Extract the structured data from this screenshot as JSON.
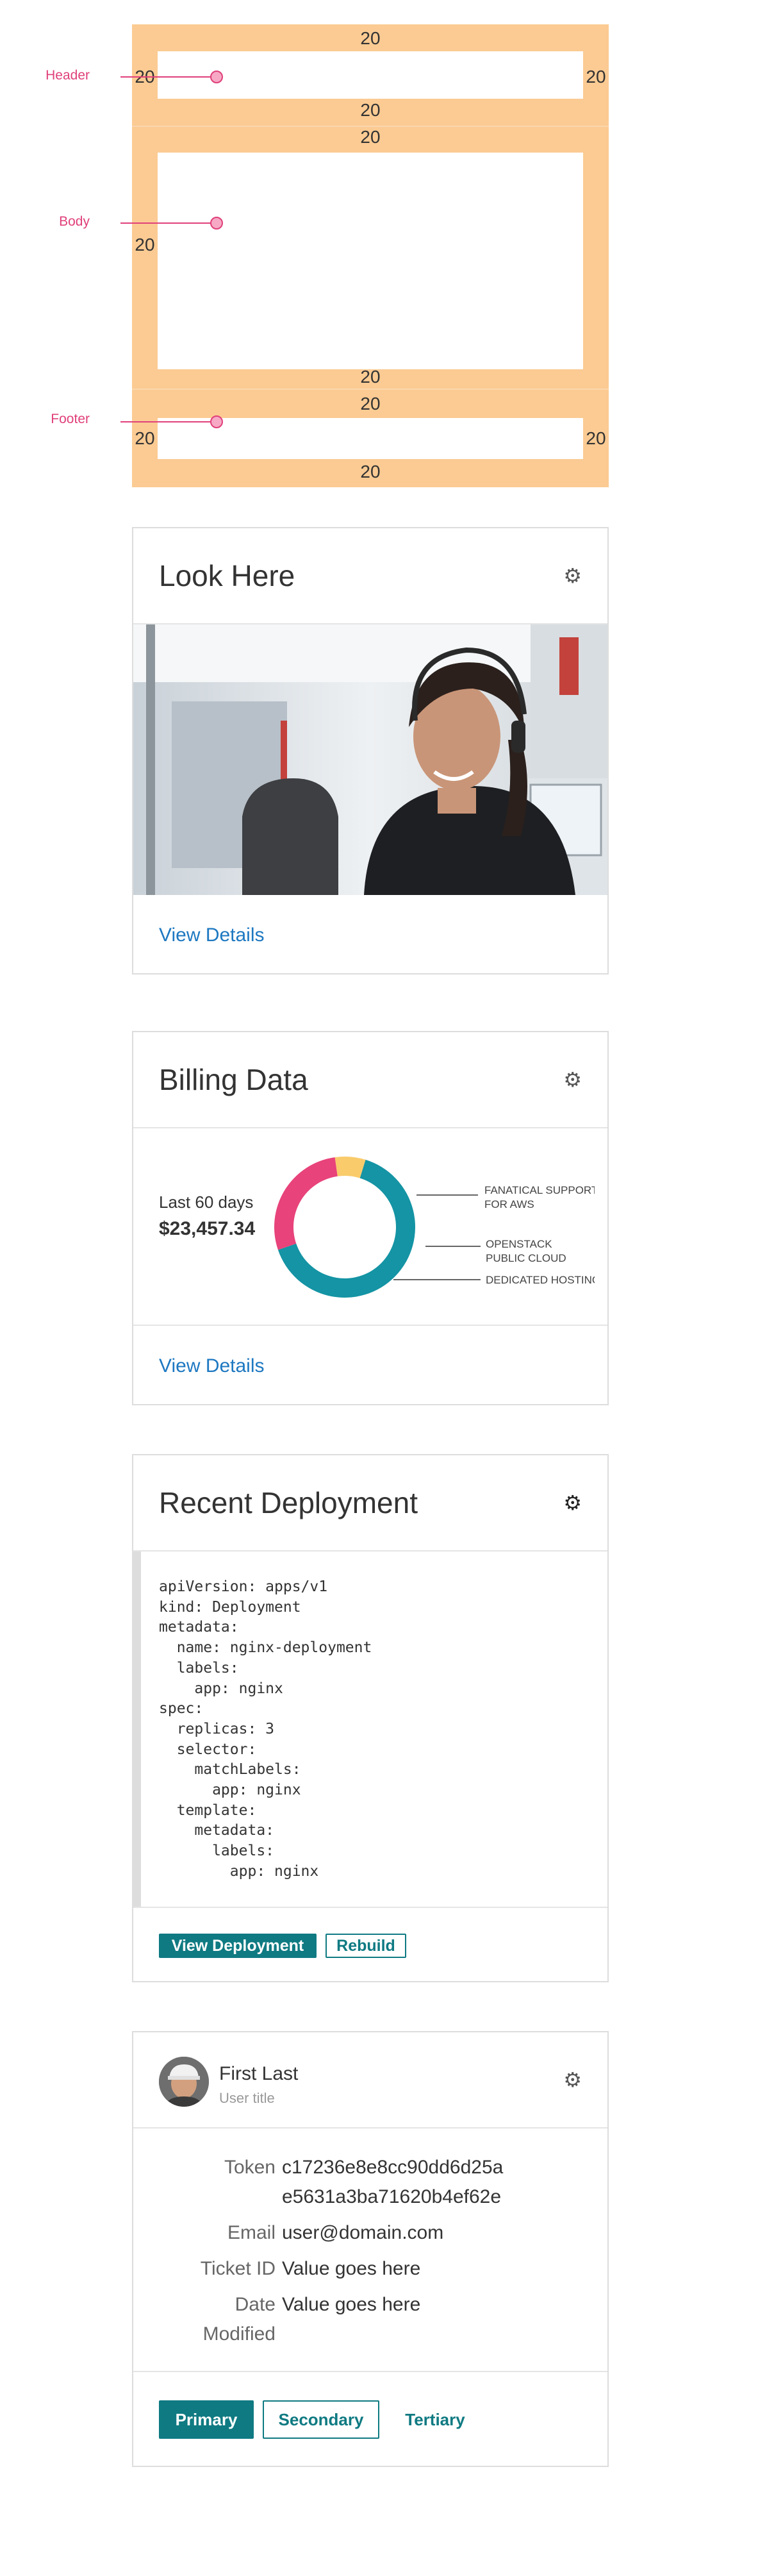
{
  "anatomy": {
    "labels": {
      "header": "Header",
      "body": "Body",
      "footer": "Footer"
    },
    "spacing": "20",
    "colors": {
      "padding": "#fbcb93",
      "callout": "#e0407a"
    }
  },
  "cards": {
    "look_here": {
      "title": "Look Here",
      "footer_link": "View Details",
      "settings_icon": "gear-icon"
    },
    "billing": {
      "title": "Billing Data",
      "period_label": "Last 60 days",
      "amount": "$23,457.34",
      "footer_link": "View Details",
      "legend": [
        {
          "line1": "FANATICAL SUPPORT",
          "line2": "FOR AWS"
        },
        {
          "line1": "OPENSTACK",
          "line2": "PUBLIC CLOUD"
        },
        {
          "line1": "DEDICATED HOSTING",
          "line2": ""
        }
      ]
    },
    "deployment": {
      "title": "Recent Deployment",
      "code": [
        "apiVersion: apps/v1",
        "kind: Deployment",
        "metadata:",
        "  name: nginx-deployment",
        "  labels:",
        "    app: nginx",
        "spec:",
        "  replicas: 3",
        "  selector:",
        "    matchLabels:",
        "      app: nginx",
        "  template:",
        "    metadata:",
        "      labels:",
        "        app: nginx"
      ],
      "primary_button": "View Deployment",
      "secondary_button": "Rebuild"
    },
    "user": {
      "name": "First Last",
      "subtitle": "User title",
      "fields": {
        "token_label": "Token",
        "token_line1": "c17236e8e8cc90dd6d25a",
        "token_line2": "e5631a3ba71620b4ef62e",
        "email_label": "Email",
        "email_value": "user@domain.com",
        "ticket_label": "Ticket ID",
        "ticket_value": "Value goes here",
        "date_label_line1": "Date",
        "date_label_line2": "Modified",
        "date_value": "Value goes here"
      },
      "buttons": {
        "primary": "Primary",
        "secondary": "Secondary",
        "tertiary": "Tertiary"
      }
    }
  },
  "chart_data": {
    "type": "pie",
    "categories": [
      "Fanatical Support for AWS",
      "OpenStack Public Cloud",
      "Dedicated Hosting"
    ],
    "values": [
      65,
      28,
      7
    ],
    "colors": [
      "#1494a4",
      "#e8437a",
      "#f9cb6b"
    ]
  }
}
